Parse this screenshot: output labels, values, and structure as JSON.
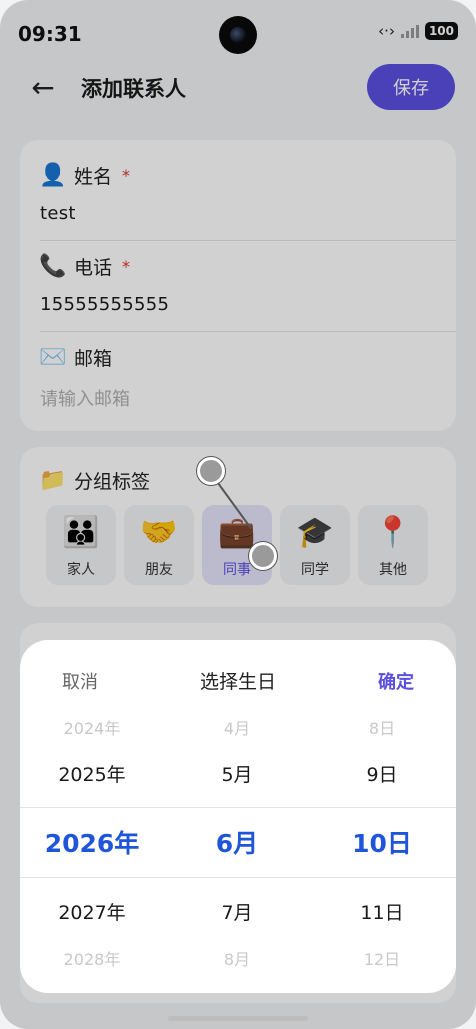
{
  "status_bar": {
    "time": "09:31",
    "battery": "100",
    "network_glyph": "‹·›"
  },
  "header": {
    "back_icon": "arrow-left-icon",
    "title": "添加联系人",
    "save_label": "保存"
  },
  "form": {
    "name": {
      "icon": "👤",
      "label": "姓名",
      "required_mark": "*",
      "value": "test"
    },
    "phone": {
      "icon": "📞",
      "label": "电话",
      "required_mark": "*",
      "value": "15555555555"
    },
    "email": {
      "icon": "✉️",
      "label": "邮箱",
      "placeholder": "请输入邮箱"
    }
  },
  "groups": {
    "icon": "📁",
    "label": "分组标签",
    "tags": [
      {
        "icon": "👪",
        "label": "家人",
        "selected": false
      },
      {
        "icon": "🤝",
        "label": "朋友",
        "selected": false
      },
      {
        "icon": "💼",
        "label": "同事",
        "selected": true
      },
      {
        "icon": "🎓",
        "label": "同学",
        "selected": false
      },
      {
        "icon": "📍",
        "label": "其他",
        "selected": false
      }
    ]
  },
  "picker": {
    "cancel_label": "取消",
    "title": "选择生日",
    "confirm_label": "确定",
    "years": [
      "2024年",
      "2025年",
      "2026年",
      "2027年",
      "2028年"
    ],
    "months": [
      "4月",
      "5月",
      "6月",
      "7月",
      "8月"
    ],
    "days": [
      "8日",
      "9日",
      "10日",
      "11日",
      "12日"
    ],
    "selected": {
      "year": "2026年",
      "month": "6月",
      "day": "10日"
    }
  },
  "colors": {
    "accent": "#5b4fe0",
    "picker_selected": "#1f55d9",
    "required": "#e0332e"
  }
}
